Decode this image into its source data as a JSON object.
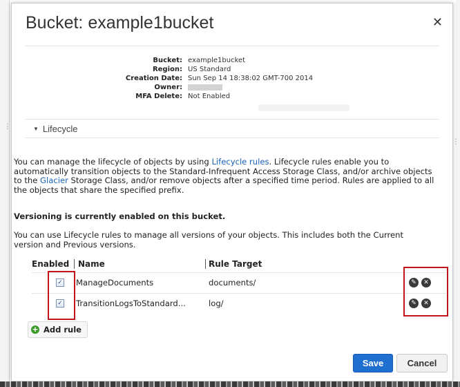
{
  "dialog": {
    "title": "Bucket: example1bucket",
    "close_icon": "close-icon"
  },
  "bucket_info": {
    "bucket_label": "Bucket:",
    "bucket_value": "example1bucket",
    "region_label": "Region:",
    "region_value": "US Standard",
    "creation_label": "Creation Date:",
    "creation_value": "Sun Sep 14 18:38:02 GMT-700 2014",
    "owner_label": "Owner:",
    "mfa_label": "MFA Delete:",
    "mfa_value": "Not Enabled"
  },
  "lifecycle": {
    "section_label": "Lifecycle",
    "intro_part1": "You can manage the lifecycle of objects by using ",
    "intro_link1": "Lifecycle rules",
    "intro_part2": ". Lifecycle rules enable you to automatically transition objects to the Standard-Infrequent Access Storage Class, and/or archive objects to the ",
    "intro_link2": "Glacier",
    "intro_part3": " Storage Class, and/or remove objects after a specified time period. Rules are applied to all the objects that share the specified prefix.",
    "versioning_status": "Versioning is currently enabled on this bucket.",
    "versions_note": "You can use Lifecycle rules to manage all versions of your objects. This includes both the Current version and Previous versions."
  },
  "rules_table": {
    "headers": {
      "enabled": "Enabled",
      "name": "Name",
      "target": "Rule Target"
    },
    "rows": [
      {
        "enabled": true,
        "name": "ManageDocuments",
        "target": "documents/"
      },
      {
        "enabled": true,
        "name": "TransitionLogsToStandard...",
        "target": "log/"
      }
    ]
  },
  "actions": {
    "add_rule": "Add rule",
    "save": "Save",
    "cancel": "Cancel"
  },
  "colors": {
    "save_button": "#1f6fd1",
    "highlight": "#c0151b",
    "link": "#1a62b5",
    "add_icon": "#3c9a2b"
  }
}
